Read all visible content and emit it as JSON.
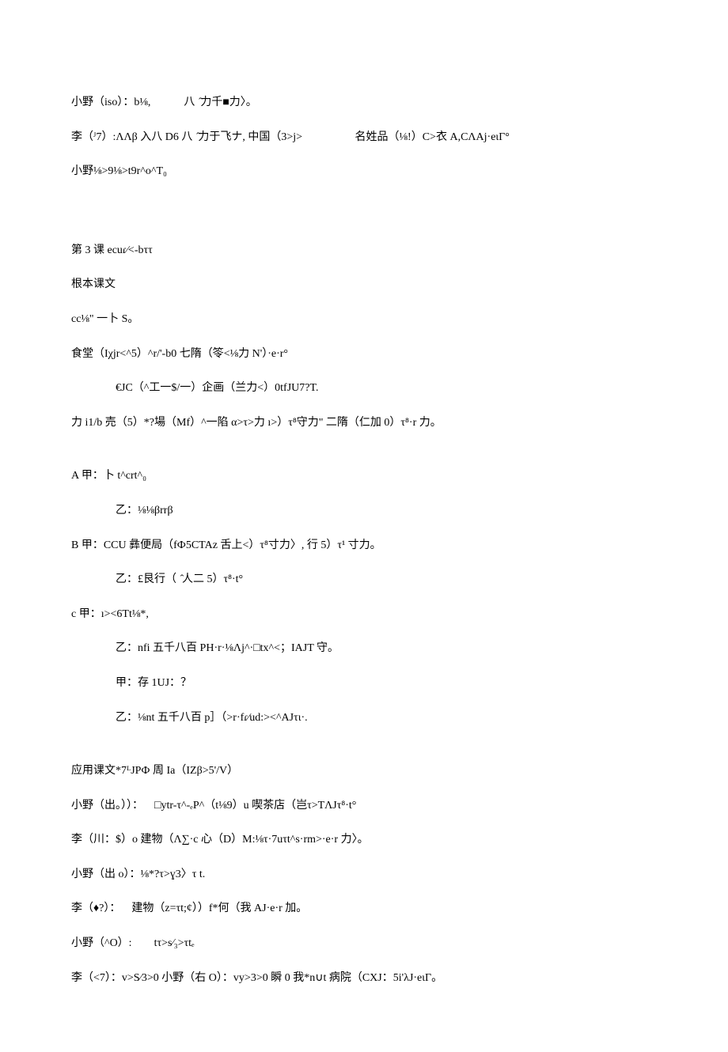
{
  "lines": [
    {
      "cls": "line gap-small",
      "text": "小野（iso）：b⅛,            八  ̂力千■力〉。"
    },
    {
      "cls": "line gap-small",
      "text": "李（ᴶ7）:ΛΛβ 入八 D6 八  ̂力于飞ナ, 中国（3>j>                   名姓品（⅛!）C>衣 A,CΛAj·eιΓ°"
    },
    {
      "cls": "line gap-large",
      "text": "小野⅛>9⅛>t9r^o^T₀"
    },
    {
      "cls": "line gap-small",
      "text": "第 3 课 ecuɾ⁄<-bττ"
    },
    {
      "cls": "line gap-small",
      "text": "根本课文"
    },
    {
      "cls": "line gap-small",
      "text": "cc⅛\" 一卜 S。"
    },
    {
      "cls": "line gap-small",
      "text": "食堂（Iχjr<^5）^r/'-b0 七隋（笭<⅛力 N'）·e·r°"
    },
    {
      "cls": "line indent gap-small",
      "text": "€JC（^工一$/一）企画（兰力<）0tfJU7?T."
    },
    {
      "cls": "line gap-med",
      "text": "力 i1/b 売（5）*?場（Mf）^一陷 α>τ>力 ı>）τ⁸守力\" 二隋（仁加 0）τ⁸·r 力。"
    },
    {
      "cls": "line gap-small",
      "text": "A 甲：卜 t^crt^₀"
    },
    {
      "cls": "line indent gap-small",
      "text": "乙：⅛⅛βrrβ"
    },
    {
      "cls": "line gap-small",
      "text": "B 甲：CCU 彝便局（fФ5CTAz 舌上<）τ⁸寸力〉, 行 5）τ¹ 寸力。"
    },
    {
      "cls": "line indent gap-small",
      "text": "乙：£艮行（  ̂人二 5）τ⁸·t°"
    },
    {
      "cls": "line gap-small",
      "text": "c 甲：ı><6Tt⅛*,"
    },
    {
      "cls": "line indent gap-small",
      "text": "乙：nfi 五千八百 PH·r·⅛Λj^·□tx^<；IAJT 守。"
    },
    {
      "cls": "line indent gap-small",
      "text": "甲：存 1UJ：？"
    },
    {
      "cls": "line indent gap-med",
      "text": "乙：⅛nt 五千八百 p］（>r·fɾ⁄ud:><^AJτι·."
    },
    {
      "cls": "line gap-small",
      "text": "应用课文*7ᴸJPФ 周 Ia（IZβ>5'/V）"
    },
    {
      "cls": "line gap-small",
      "text": "小野（出。））：    □ytr-τ^-ₑP^（t⅛9）u 喫茶店（岂τ>TΛJτ⁸·t°"
    },
    {
      "cls": "line gap-small",
      "text": "李（川：$）o 建物（Λ∑·c 心（D）M:⅛τ·7uτt^s·rm>·e·r 力〉。"
    },
    {
      "cls": "line gap-small",
      "text": "小野（出 o）：⅛*?τ>ɣ3〉τ t."
    },
    {
      "cls": "line gap-small",
      "text": "李（♦?）：    建物（z=τt;¢））f*何（我 AJ·e·r 加。"
    },
    {
      "cls": "line gap-small",
      "text": "小野（^O）:        tτ>s⁄₃>τtₑ"
    },
    {
      "cls": "line gap-small",
      "text": "李（<7）：v>S⁄3>0 小野（右 O）：vy>3>0 瞬 0 我*n∪t 病院（CXJ：5i'λJ·eιΓ。"
    }
  ]
}
